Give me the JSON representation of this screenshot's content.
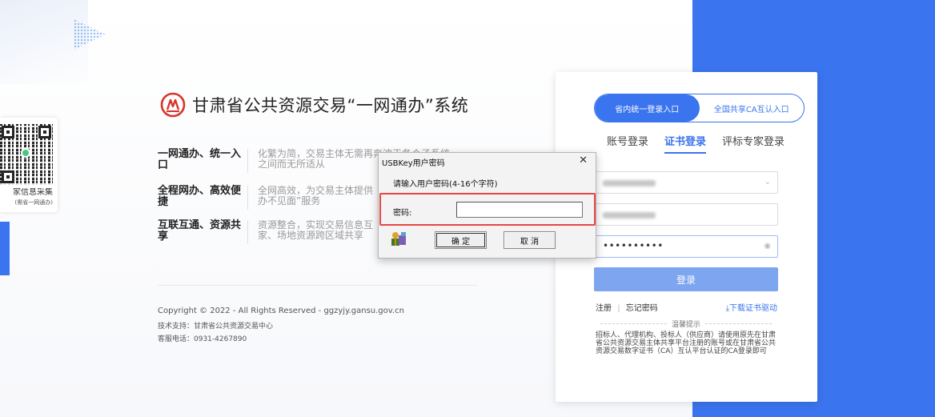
{
  "brand": {
    "title": "甘肃省公共资源交易“一网通办”系统"
  },
  "qr": {
    "caption": "家信息采集",
    "sub": "(需省一网通办)"
  },
  "features": [
    {
      "title": "一网通办、统一入口",
      "desc": "化繁为简，交易主体无需再奔波于各个子系统之间而无所适从"
    },
    {
      "title": "全程网办、高效便捷",
      "desc": "全网高效，为交易主体提供办不见面”服务"
    },
    {
      "title": "互联互通、资源共享",
      "desc": "资源整合，实现交易信息互家、场地资源跨区域共享"
    }
  ],
  "footer": {
    "copyright": "Copyright © 2022 - All Rights Reserved - ggzyjy.gansu.gov.cn",
    "support": "技术支持：甘肃省公共资源交易中心",
    "phone": "客服电话：0931-4267890"
  },
  "login": {
    "entry_tabs": [
      "省内统一登录入口",
      "全国共享CA互认入口"
    ],
    "tabs": [
      "账号登录",
      "证书登录",
      "评标专家登录"
    ],
    "password_mask": "••••••••••",
    "submit": "登录",
    "register": "注册",
    "separator": "|",
    "forgot": "忘记密码",
    "download": "⤓下载证书驱动",
    "tips_title": "温馨提示",
    "tips_body": "招标人、代理机构、投标人（供应商）请使用原先在甘肃省公共资源交易主体共享平台注册的账号或在甘肃省公共资源交易数字证书（CA）互认平台认证的CA登录即可"
  },
  "dialog": {
    "title": "USBKey用户密码",
    "close": "✕",
    "prompt": "请输入用户密码(4-16个字符)",
    "password_label": "密码:",
    "password_value": "",
    "ok": "确 定",
    "cancel": "取 消"
  },
  "colors": {
    "brand_blue": "#3a74ee",
    "logo_red": "#d9342b",
    "highlight_red": "#e84545"
  }
}
